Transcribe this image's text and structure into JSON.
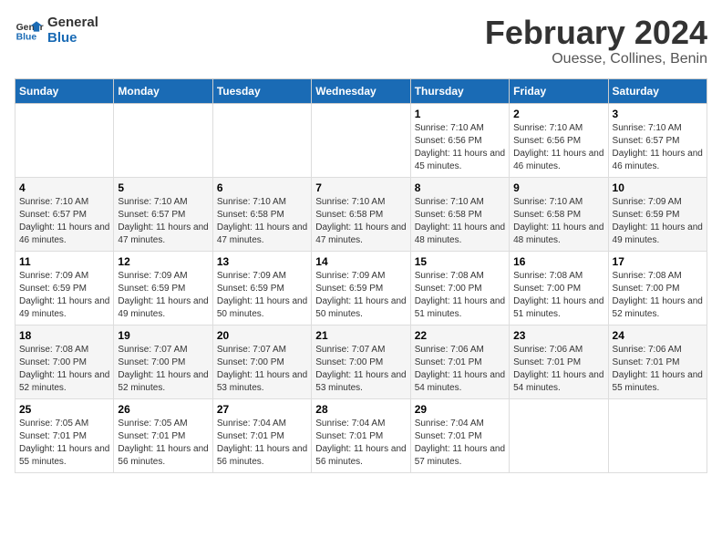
{
  "logo": {
    "line1": "General",
    "line2": "Blue"
  },
  "title": "February 2024",
  "subtitle": "Ouesse, Collines, Benin",
  "days_of_week": [
    "Sunday",
    "Monday",
    "Tuesday",
    "Wednesday",
    "Thursday",
    "Friday",
    "Saturday"
  ],
  "weeks": [
    [
      {
        "day": "",
        "info": ""
      },
      {
        "day": "",
        "info": ""
      },
      {
        "day": "",
        "info": ""
      },
      {
        "day": "",
        "info": ""
      },
      {
        "day": "1",
        "info": "Sunrise: 7:10 AM\nSunset: 6:56 PM\nDaylight: 11 hours and 45 minutes."
      },
      {
        "day": "2",
        "info": "Sunrise: 7:10 AM\nSunset: 6:56 PM\nDaylight: 11 hours and 46 minutes."
      },
      {
        "day": "3",
        "info": "Sunrise: 7:10 AM\nSunset: 6:57 PM\nDaylight: 11 hours and 46 minutes."
      }
    ],
    [
      {
        "day": "4",
        "info": "Sunrise: 7:10 AM\nSunset: 6:57 PM\nDaylight: 11 hours and 46 minutes."
      },
      {
        "day": "5",
        "info": "Sunrise: 7:10 AM\nSunset: 6:57 PM\nDaylight: 11 hours and 47 minutes."
      },
      {
        "day": "6",
        "info": "Sunrise: 7:10 AM\nSunset: 6:58 PM\nDaylight: 11 hours and 47 minutes."
      },
      {
        "day": "7",
        "info": "Sunrise: 7:10 AM\nSunset: 6:58 PM\nDaylight: 11 hours and 47 minutes."
      },
      {
        "day": "8",
        "info": "Sunrise: 7:10 AM\nSunset: 6:58 PM\nDaylight: 11 hours and 48 minutes."
      },
      {
        "day": "9",
        "info": "Sunrise: 7:10 AM\nSunset: 6:58 PM\nDaylight: 11 hours and 48 minutes."
      },
      {
        "day": "10",
        "info": "Sunrise: 7:09 AM\nSunset: 6:59 PM\nDaylight: 11 hours and 49 minutes."
      }
    ],
    [
      {
        "day": "11",
        "info": "Sunrise: 7:09 AM\nSunset: 6:59 PM\nDaylight: 11 hours and 49 minutes."
      },
      {
        "day": "12",
        "info": "Sunrise: 7:09 AM\nSunset: 6:59 PM\nDaylight: 11 hours and 49 minutes."
      },
      {
        "day": "13",
        "info": "Sunrise: 7:09 AM\nSunset: 6:59 PM\nDaylight: 11 hours and 50 minutes."
      },
      {
        "day": "14",
        "info": "Sunrise: 7:09 AM\nSunset: 6:59 PM\nDaylight: 11 hours and 50 minutes."
      },
      {
        "day": "15",
        "info": "Sunrise: 7:08 AM\nSunset: 7:00 PM\nDaylight: 11 hours and 51 minutes."
      },
      {
        "day": "16",
        "info": "Sunrise: 7:08 AM\nSunset: 7:00 PM\nDaylight: 11 hours and 51 minutes."
      },
      {
        "day": "17",
        "info": "Sunrise: 7:08 AM\nSunset: 7:00 PM\nDaylight: 11 hours and 52 minutes."
      }
    ],
    [
      {
        "day": "18",
        "info": "Sunrise: 7:08 AM\nSunset: 7:00 PM\nDaylight: 11 hours and 52 minutes."
      },
      {
        "day": "19",
        "info": "Sunrise: 7:07 AM\nSunset: 7:00 PM\nDaylight: 11 hours and 52 minutes."
      },
      {
        "day": "20",
        "info": "Sunrise: 7:07 AM\nSunset: 7:00 PM\nDaylight: 11 hours and 53 minutes."
      },
      {
        "day": "21",
        "info": "Sunrise: 7:07 AM\nSunset: 7:00 PM\nDaylight: 11 hours and 53 minutes."
      },
      {
        "day": "22",
        "info": "Sunrise: 7:06 AM\nSunset: 7:01 PM\nDaylight: 11 hours and 54 minutes."
      },
      {
        "day": "23",
        "info": "Sunrise: 7:06 AM\nSunset: 7:01 PM\nDaylight: 11 hours and 54 minutes."
      },
      {
        "day": "24",
        "info": "Sunrise: 7:06 AM\nSunset: 7:01 PM\nDaylight: 11 hours and 55 minutes."
      }
    ],
    [
      {
        "day": "25",
        "info": "Sunrise: 7:05 AM\nSunset: 7:01 PM\nDaylight: 11 hours and 55 minutes."
      },
      {
        "day": "26",
        "info": "Sunrise: 7:05 AM\nSunset: 7:01 PM\nDaylight: 11 hours and 56 minutes."
      },
      {
        "day": "27",
        "info": "Sunrise: 7:04 AM\nSunset: 7:01 PM\nDaylight: 11 hours and 56 minutes."
      },
      {
        "day": "28",
        "info": "Sunrise: 7:04 AM\nSunset: 7:01 PM\nDaylight: 11 hours and 56 minutes."
      },
      {
        "day": "29",
        "info": "Sunrise: 7:04 AM\nSunset: 7:01 PM\nDaylight: 11 hours and 57 minutes."
      },
      {
        "day": "",
        "info": ""
      },
      {
        "day": "",
        "info": ""
      }
    ]
  ]
}
